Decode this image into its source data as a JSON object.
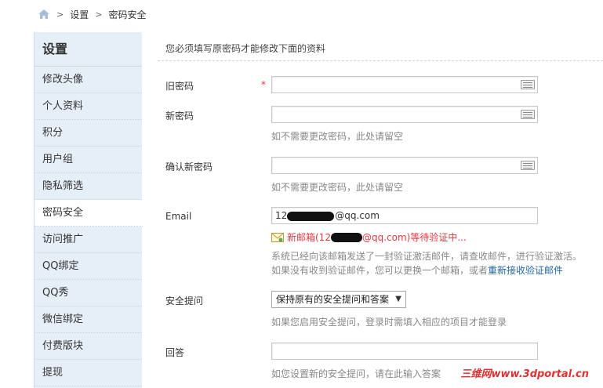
{
  "breadcrumb": {
    "sep1": ">",
    "item1": "设置",
    "sep2": ">",
    "item2": "密码安全"
  },
  "sidebar": {
    "title": "设置",
    "items": [
      {
        "label": "修改头像"
      },
      {
        "label": "个人资料"
      },
      {
        "label": "积分"
      },
      {
        "label": "用户组"
      },
      {
        "label": "隐私筛选"
      },
      {
        "label": "密码安全",
        "active": true
      },
      {
        "label": "访问推广"
      },
      {
        "label": "QQ绑定"
      },
      {
        "label": "QQ秀"
      },
      {
        "label": "微信绑定"
      },
      {
        "label": "付费版块"
      },
      {
        "label": "提现"
      }
    ]
  },
  "form": {
    "notice": "您必须填写原密码才能修改下面的资料",
    "old_password": {
      "label": "旧密码",
      "required": "*",
      "value": ""
    },
    "new_password": {
      "label": "新密码",
      "value": "",
      "hint": "如不需要更改密码，此处请留空"
    },
    "confirm_password": {
      "label": "确认新密码",
      "value": "",
      "hint": "如不需要更改密码，此处请留空"
    },
    "email": {
      "label": "Email",
      "value_prefix": "12",
      "value_suffix": "@qq.com",
      "verify_prefix": "新邮箱(12",
      "verify_suffix": "@qq.com)等待验证中...",
      "message_line1": "系统已经向该邮箱发送了一封验证激活邮件，请查收邮件，进行验证激活。",
      "message_line2": "如果没有收到验证邮件，您可以更换一个邮箱，或者",
      "resend_link": "重新接收验证邮件"
    },
    "security_question": {
      "label": "安全提问",
      "selected": "保持原有的安全提问和答案",
      "hint": "如果您启用安全提问，登录时需填入相应的项目才能登录"
    },
    "answer": {
      "label": "回答",
      "value": "",
      "hint": "如您设置新的安全提问，请在此输入答案"
    }
  },
  "watermark": {
    "cn": "三维网",
    "url": "www.3dportal.cn"
  },
  "colors": {
    "sidebar_bg": "#e6eef7",
    "required_red": "#e4393c",
    "link_blue": "#2366a8"
  }
}
